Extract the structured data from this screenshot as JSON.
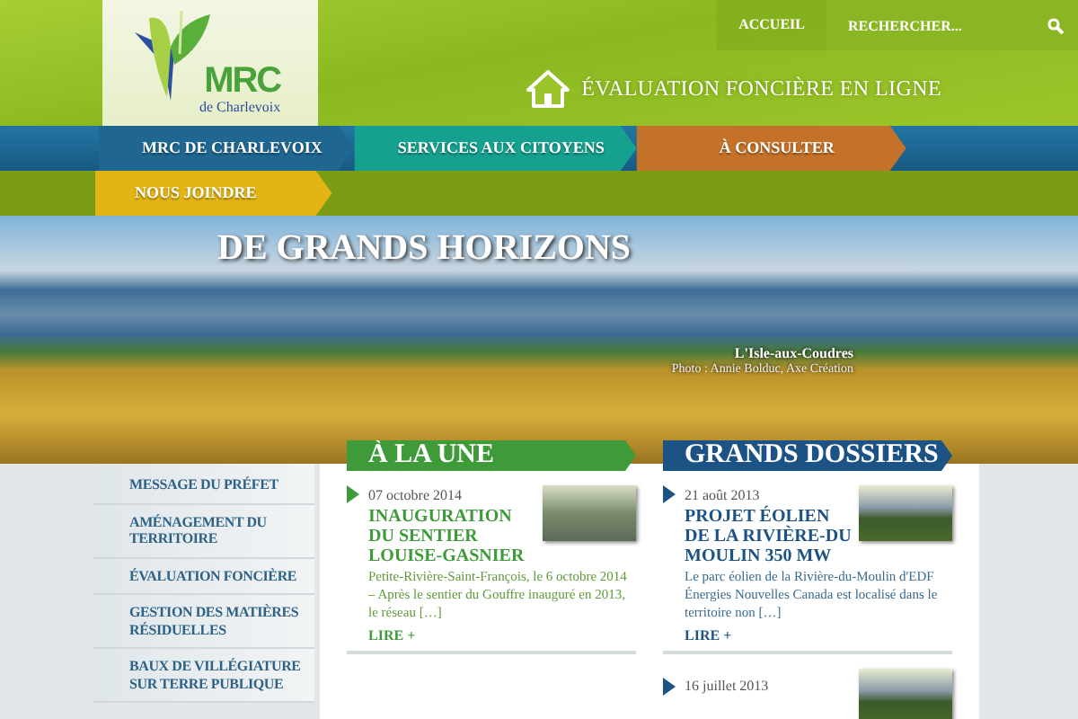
{
  "header": {
    "logo": {
      "name": "MRC",
      "subtitle": "de Charlevoix"
    },
    "top_links": [
      {
        "label": "ACCUEIL"
      }
    ],
    "search": {
      "placeholder": "RECHERCHER..."
    },
    "feature_link": "ÉVALUATION FONCIÈRE EN LIGNE"
  },
  "nav": {
    "items": [
      {
        "label": "MRC DE CHARLEVOIX",
        "color": "#1f6690"
      },
      {
        "label": "SERVICES AUX CITOYENS",
        "color": "#16a08f"
      },
      {
        "label": "À CONSULTER",
        "color": "#c4722a"
      }
    ],
    "second_row": [
      {
        "label": "NOUS JOINDRE",
        "color": "#e2b414"
      }
    ]
  },
  "banner": {
    "title": "DE GRANDS HORIZONS",
    "caption": "L'Isle-aux-Coudres",
    "credit": "Photo : Annie Bolduc, Axe Création"
  },
  "sidebar": {
    "items": [
      {
        "label": "MESSAGE DU PRÉFET"
      },
      {
        "label": "AMÉNAGEMENT DU TERRITOIRE"
      },
      {
        "label": "ÉVALUATION FONCIÈRE"
      },
      {
        "label": "GESTION DES MATIÈRES RÉSIDUELLES"
      },
      {
        "label": "BAUX DE VILLÉGIATURE SUR TERRE PUBLIQUE"
      }
    ]
  },
  "sections": [
    {
      "title": "À LA UNE",
      "color": "#3f9a3a",
      "articles": [
        {
          "date": "07 octobre 2014",
          "title": "INAUGURATION DU SENTIER LOUISE-GASNIER",
          "excerpt": "Petite-Rivière-Saint-François, le 6 octobre 2014 – Après le sentier du Gouffre inauguré en 2013, le réseau […]",
          "more": "LIRE +"
        }
      ]
    },
    {
      "title": "GRANDS DOSSIERS",
      "color": "#1d5384",
      "articles": [
        {
          "date": "21 août 2013",
          "title": "PROJET ÉOLIEN DE LA RIVIÈRE-DU MOULIN 350 MW",
          "excerpt": "Le  parc éolien de la Rivière-du-Moulin d'EDF Énergies Nouvelles Canada est localisé dans le territoire non […]",
          "more": "LIRE +"
        },
        {
          "date": "16 juillet 2013"
        }
      ]
    }
  ]
}
